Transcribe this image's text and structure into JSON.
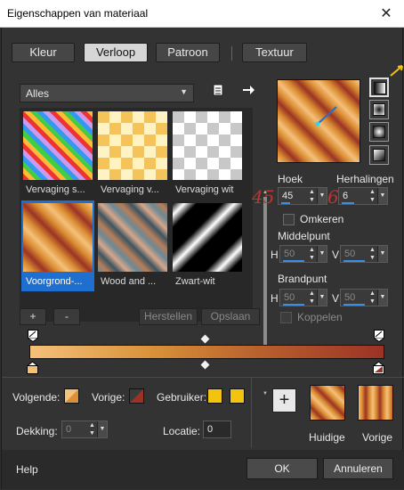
{
  "window": {
    "title": "Eigenschappen van materiaal",
    "close_glyph": "✕"
  },
  "tabs": [
    {
      "label": "Kleur"
    },
    {
      "label": "Verloop"
    },
    {
      "label": "Patroon"
    },
    {
      "label": "Textuur"
    }
  ],
  "library": {
    "dropdown_value": "Alles",
    "items": [
      {
        "label": "Vervaging s...",
        "selected": false
      },
      {
        "label": "Vervaging v...",
        "selected": false
      },
      {
        "label": "Vervaging wit",
        "selected": false
      },
      {
        "label": "Voorgrond-...",
        "selected": true
      },
      {
        "label": "Wood and ...",
        "selected": false
      },
      {
        "label": "Zwart-wit",
        "selected": false
      }
    ],
    "add_label": "+",
    "remove_label": "-",
    "restore_label": "Herstellen",
    "save_label": "Opslaan"
  },
  "params": {
    "angle_label": "Hoek",
    "angle_value": "45",
    "repeats_label": "Herhalingen",
    "repeats_value": "6",
    "invert_label": "Omkeren",
    "center_label": "Middelpunt",
    "center_h": "50",
    "center_v": "50",
    "focus_label": "Brandpunt",
    "focus_h": "50",
    "focus_v": "50",
    "link_label": "Koppelen",
    "h_label": "H",
    "v_label": "V"
  },
  "annotations": {
    "left": "45",
    "right": "6"
  },
  "editor": {
    "next_label": "Volgende:",
    "prev_label": "Vorige:",
    "user_label": "Gebruiker:",
    "opacity_label": "Dekking:",
    "opacity_value": "0",
    "location_label": "Locatie:",
    "location_value": "0",
    "add_glyph": "+",
    "current_label": "Huidige",
    "previous_label": "Vorige"
  },
  "footer": {
    "help_label": "Help",
    "ok_label": "OK",
    "cancel_label": "Annuleren"
  },
  "colors": {
    "accent": "#1f6fd0",
    "user_color": "#f2c40f",
    "gradient_start": "#f5c07a",
    "gradient_end": "#9b3325",
    "annotation": "#c2332a"
  }
}
